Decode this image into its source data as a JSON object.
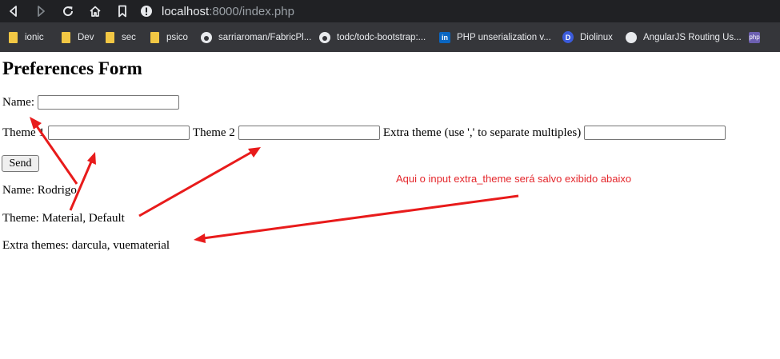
{
  "browser": {
    "url_host": "localhost",
    "url_rest": ":8000/index.php",
    "bookmarks": [
      {
        "label": "ionic",
        "icon": "folder-icon"
      },
      {
        "label": "Dev",
        "icon": "folder-icon"
      },
      {
        "label": "sec",
        "icon": "folder-icon"
      },
      {
        "label": "psico",
        "icon": "folder-icon"
      },
      {
        "label": "sarriaroman/FabricPl...",
        "icon": "github-icon"
      },
      {
        "label": "todc/todc-bootstrap:...",
        "icon": "github-icon"
      },
      {
        "label": "PHP unserialization v...",
        "icon": "linkedin-icon"
      },
      {
        "label": "Diolinux",
        "icon": "diolinux-icon"
      },
      {
        "label": "AngularJS Routing Us...",
        "icon": "globe-icon"
      },
      {
        "label": "",
        "icon": "php-icon"
      }
    ]
  },
  "form": {
    "title": "Preferences Form",
    "name_label": "Name:",
    "theme1_label": "Theme 1",
    "theme2_label": "Theme 2",
    "extra_label": "Extra theme (use ',' to separate multiples)",
    "send_label": "Send"
  },
  "output": {
    "name_line": "Name: Rodrigo",
    "theme_line": "Theme: Material, Default",
    "extra_line": "Extra themes: darcula, vuematerial"
  },
  "annotation": {
    "text": "Aqui o input extra_theme será salvo exibido abaixo",
    "color": "#e4262b"
  },
  "colors": {
    "toolbar_bg": "#202124",
    "bookmarks_bg": "#35363a",
    "arrow": "#e81b1b"
  }
}
